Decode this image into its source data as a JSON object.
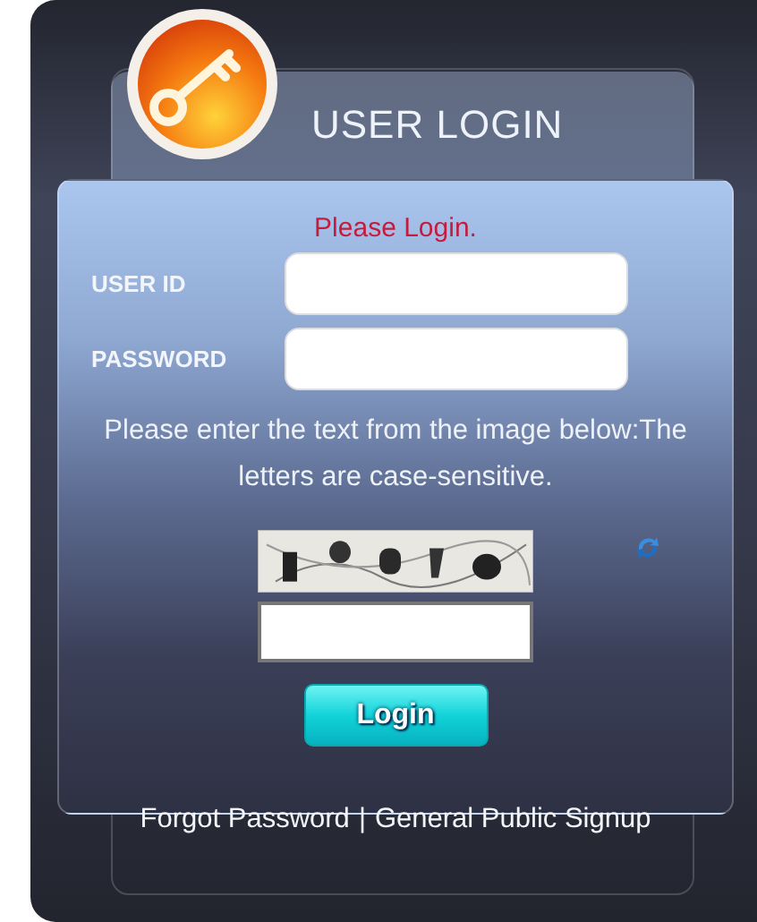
{
  "header": {
    "title": "USER LOGIN"
  },
  "form": {
    "message": "Please Login.",
    "fields": [
      {
        "label": "USER ID"
      },
      {
        "label": "PASSWORD"
      }
    ],
    "captcha": {
      "instruction": "Please enter the text from the image below:The letters are case-sensitive."
    },
    "button": "Login"
  },
  "links": [
    {
      "label": "Forgot Password"
    },
    {
      "label": "General Public Signup"
    }
  ],
  "link_separator": "|"
}
